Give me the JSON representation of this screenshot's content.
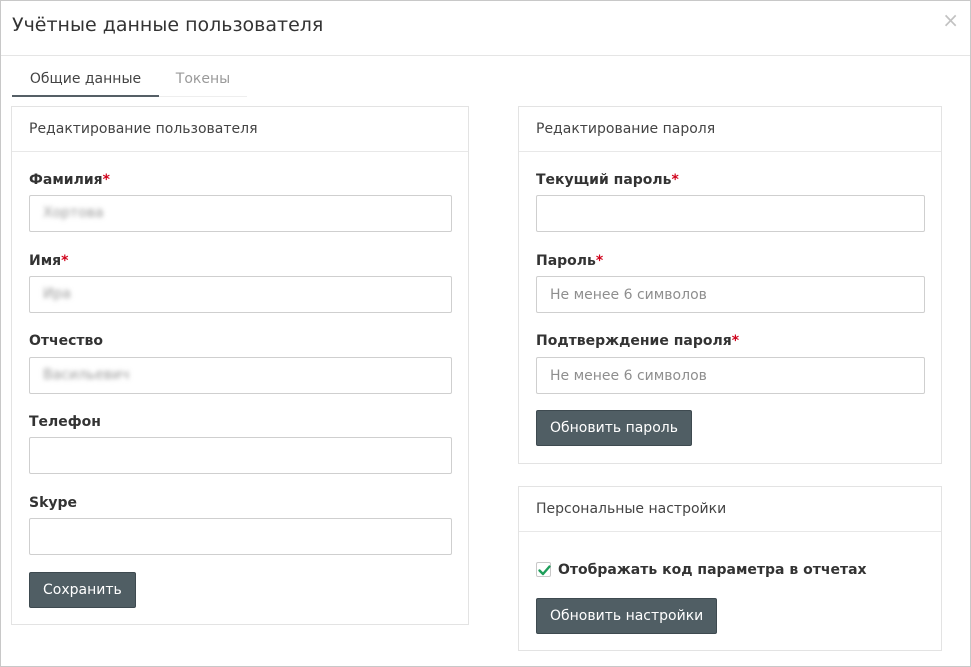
{
  "window": {
    "title": "Учётные данные пользователя",
    "close_glyph": "×"
  },
  "tabs": [
    {
      "label": "Общие данные",
      "active": true
    },
    {
      "label": "Токены",
      "active": false
    }
  ],
  "user_panel": {
    "heading": "Редактирование пользователя",
    "fields": {
      "last_name": {
        "label": "Фамилия",
        "required": "*",
        "value": "Хортова"
      },
      "first_name": {
        "label": "Имя",
        "required": "*",
        "value": "Ира"
      },
      "patronymic": {
        "label": "Отчество",
        "value": "Васильевич"
      },
      "phone": {
        "label": "Телефон",
        "value": ""
      },
      "skype": {
        "label": "Skype",
        "value": ""
      }
    },
    "save_label": "Сохранить"
  },
  "password_panel": {
    "heading": "Редактирование пароля",
    "fields": {
      "current": {
        "label": "Текущий пароль",
        "required": "*",
        "value": ""
      },
      "new": {
        "label": "Пароль",
        "required": "*",
        "placeholder": "Не менее 6 символов"
      },
      "confirm": {
        "label": "Подтверждение пароля",
        "required": "*",
        "placeholder": "Не менее 6 символов"
      }
    },
    "update_label": "Обновить пароль"
  },
  "settings_panel": {
    "heading": "Персональные настройки",
    "show_param_code": {
      "label": "Отображать код параметра в отчетах",
      "checked": true
    },
    "update_label": "Обновить настройки"
  },
  "colors": {
    "button_bg": "#505e64",
    "required": "#d0021b",
    "checkmark": "#1e9e5a"
  }
}
